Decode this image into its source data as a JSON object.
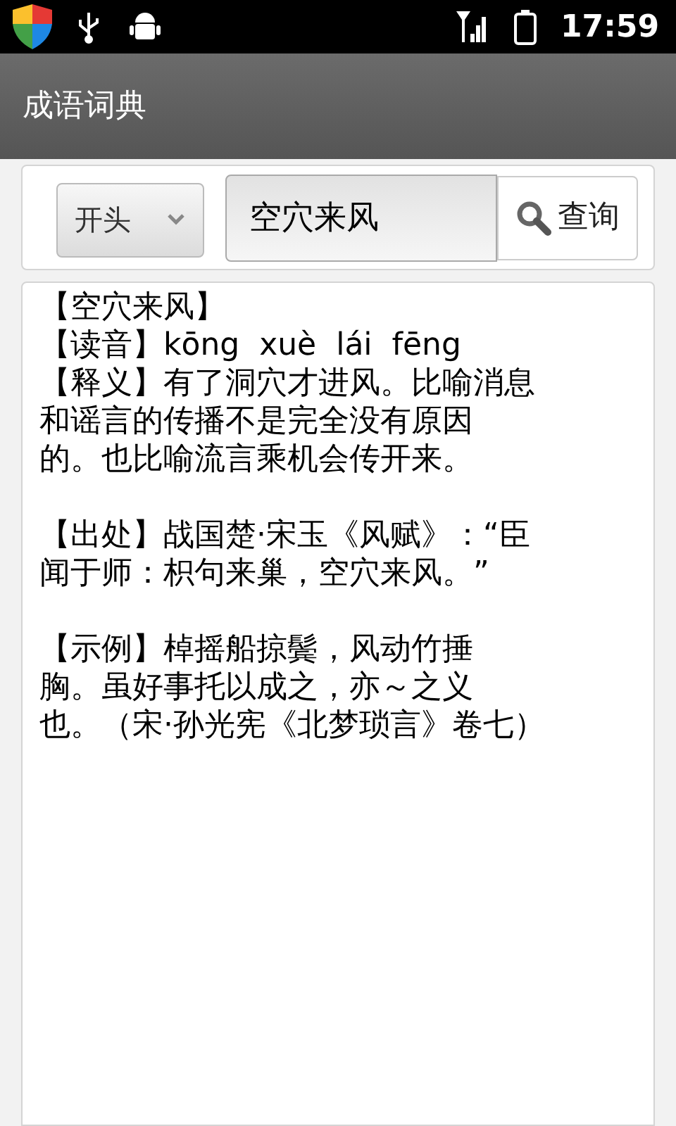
{
  "status_bar": {
    "time": "17:59"
  },
  "title_bar": {
    "title": "成语词典"
  },
  "search": {
    "mode": "开头",
    "query": "空穴来风",
    "button": "查询"
  },
  "result": {
    "paragraphs": [
      [
        "【空穴来风】",
        "【读音】kōng  xuè  lái  fēng",
        "【释义】有了洞穴才进风。比喻消息",
        "和谣言的传播不是完全没有原因",
        "的。也比喻流言乘机会传开来。"
      ],
      [
        "【出处】战国楚·宋玉《风赋》：“臣",
        "闻于师：枳句来巢，空穴来风。”"
      ],
      [
        "【示例】棹摇船掠鬓，风动竹捶",
        "胸。虽好事托以成之，亦～之义",
        "也。（宋·孙光宪《北梦琐言》卷七）"
      ]
    ]
  }
}
